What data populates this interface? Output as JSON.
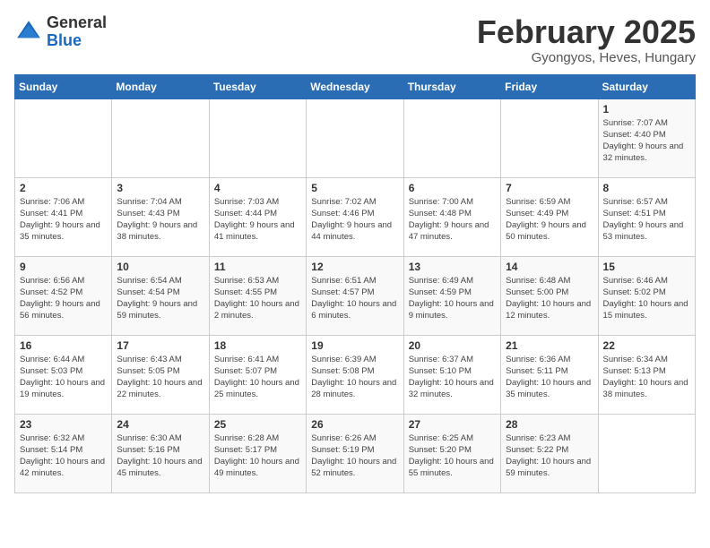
{
  "header": {
    "logo_general": "General",
    "logo_blue": "Blue",
    "title": "February 2025",
    "subtitle": "Gyongyos, Heves, Hungary"
  },
  "weekdays": [
    "Sunday",
    "Monday",
    "Tuesday",
    "Wednesday",
    "Thursday",
    "Friday",
    "Saturday"
  ],
  "weeks": [
    [
      null,
      null,
      null,
      null,
      null,
      null,
      {
        "day": "1",
        "sunrise": "7:07 AM",
        "sunset": "4:40 PM",
        "daylight": "9 hours and 32 minutes."
      }
    ],
    [
      {
        "day": "2",
        "sunrise": "7:06 AM",
        "sunset": "4:41 PM",
        "daylight": "9 hours and 35 minutes."
      },
      {
        "day": "3",
        "sunrise": "7:04 AM",
        "sunset": "4:43 PM",
        "daylight": "9 hours and 38 minutes."
      },
      {
        "day": "4",
        "sunrise": "7:03 AM",
        "sunset": "4:44 PM",
        "daylight": "9 hours and 41 minutes."
      },
      {
        "day": "5",
        "sunrise": "7:02 AM",
        "sunset": "4:46 PM",
        "daylight": "9 hours and 44 minutes."
      },
      {
        "day": "6",
        "sunrise": "7:00 AM",
        "sunset": "4:48 PM",
        "daylight": "9 hours and 47 minutes."
      },
      {
        "day": "7",
        "sunrise": "6:59 AM",
        "sunset": "4:49 PM",
        "daylight": "9 hours and 50 minutes."
      },
      {
        "day": "8",
        "sunrise": "6:57 AM",
        "sunset": "4:51 PM",
        "daylight": "9 hours and 53 minutes."
      }
    ],
    [
      {
        "day": "9",
        "sunrise": "6:56 AM",
        "sunset": "4:52 PM",
        "daylight": "9 hours and 56 minutes."
      },
      {
        "day": "10",
        "sunrise": "6:54 AM",
        "sunset": "4:54 PM",
        "daylight": "9 hours and 59 minutes."
      },
      {
        "day": "11",
        "sunrise": "6:53 AM",
        "sunset": "4:55 PM",
        "daylight": "10 hours and 2 minutes."
      },
      {
        "day": "12",
        "sunrise": "6:51 AM",
        "sunset": "4:57 PM",
        "daylight": "10 hours and 6 minutes."
      },
      {
        "day": "13",
        "sunrise": "6:49 AM",
        "sunset": "4:59 PM",
        "daylight": "10 hours and 9 minutes."
      },
      {
        "day": "14",
        "sunrise": "6:48 AM",
        "sunset": "5:00 PM",
        "daylight": "10 hours and 12 minutes."
      },
      {
        "day": "15",
        "sunrise": "6:46 AM",
        "sunset": "5:02 PM",
        "daylight": "10 hours and 15 minutes."
      }
    ],
    [
      {
        "day": "16",
        "sunrise": "6:44 AM",
        "sunset": "5:03 PM",
        "daylight": "10 hours and 19 minutes."
      },
      {
        "day": "17",
        "sunrise": "6:43 AM",
        "sunset": "5:05 PM",
        "daylight": "10 hours and 22 minutes."
      },
      {
        "day": "18",
        "sunrise": "6:41 AM",
        "sunset": "5:07 PM",
        "daylight": "10 hours and 25 minutes."
      },
      {
        "day": "19",
        "sunrise": "6:39 AM",
        "sunset": "5:08 PM",
        "daylight": "10 hours and 28 minutes."
      },
      {
        "day": "20",
        "sunrise": "6:37 AM",
        "sunset": "5:10 PM",
        "daylight": "10 hours and 32 minutes."
      },
      {
        "day": "21",
        "sunrise": "6:36 AM",
        "sunset": "5:11 PM",
        "daylight": "10 hours and 35 minutes."
      },
      {
        "day": "22",
        "sunrise": "6:34 AM",
        "sunset": "5:13 PM",
        "daylight": "10 hours and 38 minutes."
      }
    ],
    [
      {
        "day": "23",
        "sunrise": "6:32 AM",
        "sunset": "5:14 PM",
        "daylight": "10 hours and 42 minutes."
      },
      {
        "day": "24",
        "sunrise": "6:30 AM",
        "sunset": "5:16 PM",
        "daylight": "10 hours and 45 minutes."
      },
      {
        "day": "25",
        "sunrise": "6:28 AM",
        "sunset": "5:17 PM",
        "daylight": "10 hours and 49 minutes."
      },
      {
        "day": "26",
        "sunrise": "6:26 AM",
        "sunset": "5:19 PM",
        "daylight": "10 hours and 52 minutes."
      },
      {
        "day": "27",
        "sunrise": "6:25 AM",
        "sunset": "5:20 PM",
        "daylight": "10 hours and 55 minutes."
      },
      {
        "day": "28",
        "sunrise": "6:23 AM",
        "sunset": "5:22 PM",
        "daylight": "10 hours and 59 minutes."
      },
      null
    ]
  ]
}
